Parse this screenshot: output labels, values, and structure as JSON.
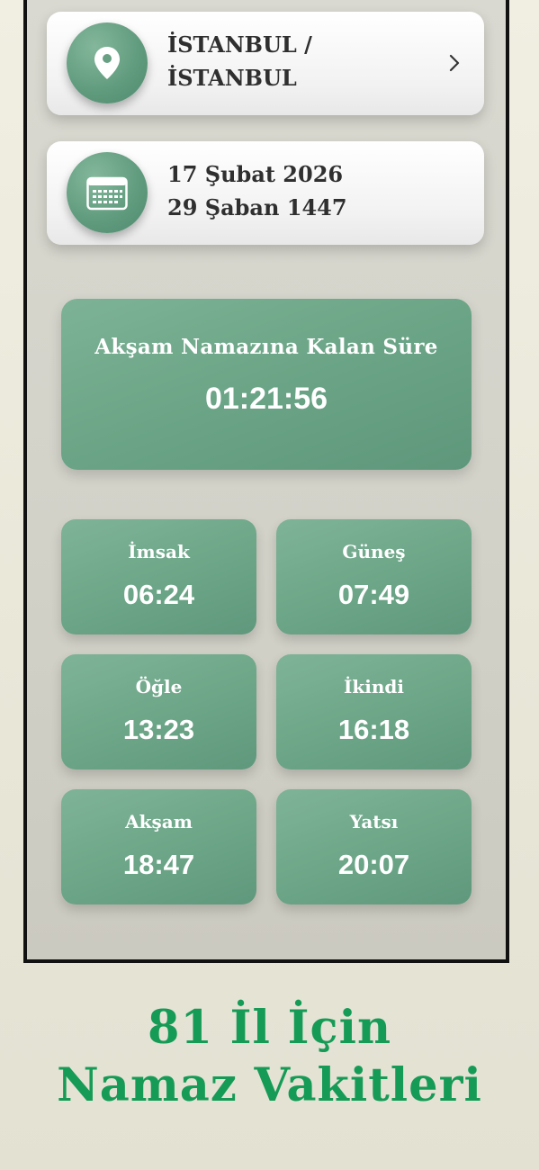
{
  "location": {
    "line1": "İSTANBUL /",
    "line2": "İSTANBUL"
  },
  "date": {
    "gregorian": "17 Şubat 2026",
    "hijri": "29 Şaban 1447"
  },
  "countdown": {
    "label": "Akşam Namazına Kalan Süre",
    "time": "01:21:56"
  },
  "prayers": [
    {
      "name": "İmsak",
      "time": "06:24"
    },
    {
      "name": "Güneş",
      "time": "07:49"
    },
    {
      "name": "Öğle",
      "time": "13:23"
    },
    {
      "name": "İkindi",
      "time": "16:18"
    },
    {
      "name": "Akşam",
      "time": "18:47"
    },
    {
      "name": "Yatsı",
      "time": "20:07"
    }
  ],
  "caption": {
    "line1": "81 İl İçin",
    "line2": "Namaz Vakitleri"
  },
  "colors": {
    "accent_green": "#6ba486",
    "caption_green": "#169b56"
  },
  "icons": {
    "location": "map-pin-icon",
    "date": "calendar-icon",
    "chevron": "chevron-right-icon"
  }
}
